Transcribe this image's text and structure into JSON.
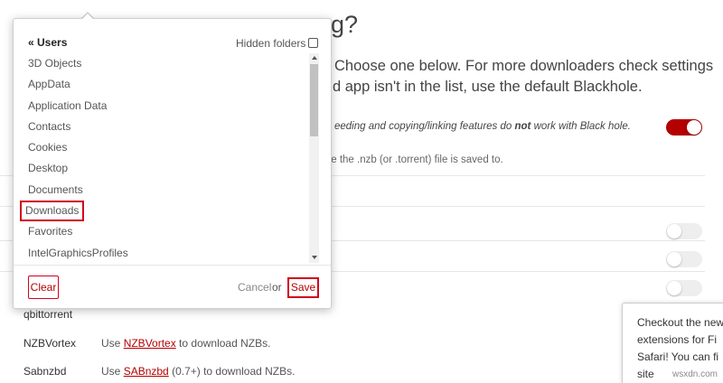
{
  "background": {
    "heading": "g?",
    "description_line1": "Choose one below. For more downloaders check settings",
    "description_line2": "d app isn't in the list, use the default Blackhole.",
    "warning_pre": "eeding and copying/linking features do ",
    "warning_bold": "not",
    "warning_post": " work with Black hole.",
    "help_text": "ere the .nzb (or .torrent) file is saved to.",
    "downloaders": [
      {
        "name": "qbittorrent",
        "desc_pre": "",
        "link": "",
        "desc_post": ""
      },
      {
        "name": "NZBVortex",
        "desc_pre": "Use ",
        "link": "NZBVortex",
        "desc_post": " to download NZBs."
      },
      {
        "name": "Sabnzbd",
        "desc_pre": "Use ",
        "link": "SABnzbd",
        "desc_post": " (0.7+) to download NZBs."
      }
    ],
    "callout": {
      "line1": "Checkout the new",
      "line2": "extensions for Fi",
      "line3": "Safari! You can fi",
      "line4": "site"
    },
    "watermark": "wsxdn.com"
  },
  "dialog": {
    "breadcrumb": "« Users",
    "hidden_folders_label": "Hidden folders",
    "hidden_folders_checked": false,
    "folders": [
      "3D Objects",
      "AppData",
      "Application Data",
      "Contacts",
      "Cookies",
      "Desktop",
      "Documents",
      "Downloads",
      "Favorites",
      "IntelGraphicsProfiles"
    ],
    "highlighted_folder": "Downloads",
    "clear_label": "Clear",
    "cancel_label": "Cancel",
    "or_label": "or",
    "save_label": "Save"
  },
  "colors": {
    "accent": "#b30000",
    "highlight_box": "#d0021b"
  }
}
